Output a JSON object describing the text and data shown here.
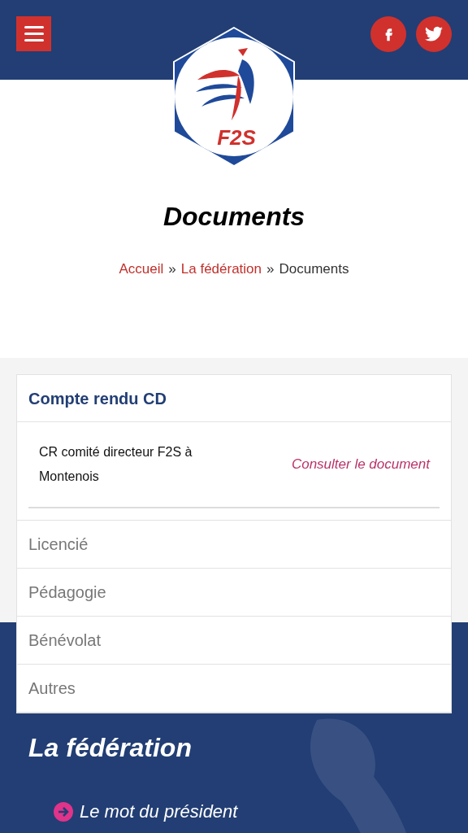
{
  "header": {
    "logo_text": "F2S"
  },
  "page_title": "Documents",
  "breadcrumb": [
    {
      "label": "Accueil",
      "link": true
    },
    {
      "label": "»",
      "link": false
    },
    {
      "label": "La fédération",
      "link": true
    },
    {
      "label": "»",
      "link": false
    },
    {
      "label": "Documents",
      "link": false
    }
  ],
  "accordion": [
    {
      "title": "Compte rendu CD",
      "expanded": true,
      "documents": [
        {
          "name": "CR comité directeur F2S à Montenois",
          "action": "Consulter le document"
        }
      ]
    },
    {
      "title": "Licencié",
      "expanded": false
    },
    {
      "title": "Pédagogie",
      "expanded": false
    },
    {
      "title": "Bénévolat",
      "expanded": false
    },
    {
      "title": "Autres",
      "expanded": false
    }
  ],
  "footer": {
    "title": "La fédération",
    "links": [
      "Le mot du président"
    ]
  }
}
